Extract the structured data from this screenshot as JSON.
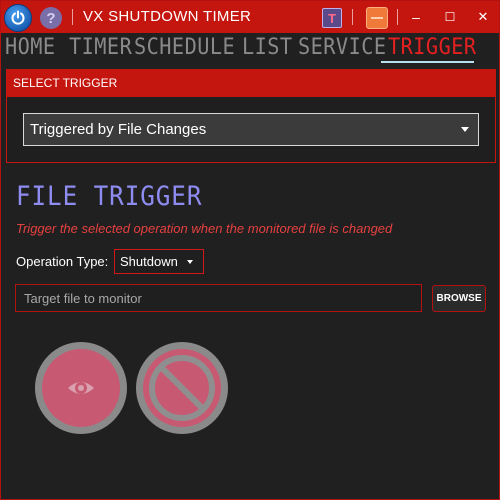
{
  "window": {
    "title": "VX SHUTDOWN TIMER",
    "help_glyph": "?",
    "t_glyph": "T",
    "controls": {
      "minimize": "‒",
      "maximize": "☐",
      "close": "✕"
    }
  },
  "nav": {
    "items": [
      {
        "label": "HOME",
        "active": false
      },
      {
        "label": "TIMER",
        "active": false
      },
      {
        "label": "SCHEDULE",
        "active": false
      },
      {
        "label": "LIST",
        "active": false
      },
      {
        "label": "SERVICE",
        "active": false
      },
      {
        "label": "TRIGGER",
        "active": true
      }
    ]
  },
  "select_trigger": {
    "header": "SELECT TRIGGER",
    "selected": "Triggered by File Changes"
  },
  "content": {
    "heading": "FILE TRIGGER",
    "description": "Trigger the selected operation when the monitored file is changed",
    "operation_label": "Operation Type:",
    "operation_value": "Shutdown",
    "file_placeholder": "Target file to monitor",
    "browse_label": "BROWSE"
  },
  "buttons": {
    "monitor": {
      "icon": "eye-icon"
    },
    "cancel": {
      "icon": "prohibited-icon"
    }
  },
  "colors": {
    "accent_red": "#c4150e",
    "heading_purple": "#8e8cf0",
    "description_red": "#e64040",
    "underline_blue": "#b8dff0",
    "button_pink": "#c75a72"
  }
}
